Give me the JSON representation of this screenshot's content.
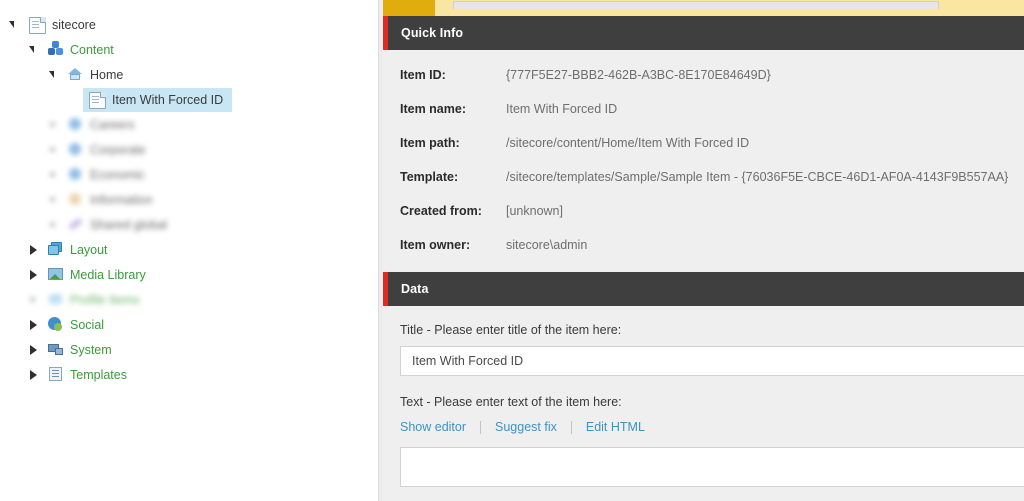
{
  "sidebar": {
    "tree": [
      {
        "label": "sitecore",
        "icon": "document-icon",
        "indent": 0,
        "twisty": "expanded",
        "green": false,
        "selected": false,
        "blurred": false
      },
      {
        "label": "Content",
        "icon": "cubes-icon",
        "indent": 1,
        "twisty": "expanded",
        "green": true,
        "selected": false,
        "blurred": false
      },
      {
        "label": "Home",
        "icon": "home-icon",
        "indent": 2,
        "twisty": "expanded",
        "green": false,
        "selected": false,
        "blurred": false
      },
      {
        "label": "Item With Forced ID",
        "icon": "document-icon",
        "indent": 3,
        "twisty": "none-hidden",
        "green": false,
        "selected": true,
        "blurred": false
      },
      {
        "label": "Careers",
        "icon": "globe-blue-icon",
        "indent": 2,
        "twisty": "none",
        "green": false,
        "selected": false,
        "blurred": true
      },
      {
        "label": "Corporate",
        "icon": "globe-blue-icon",
        "indent": 2,
        "twisty": "none",
        "green": false,
        "selected": false,
        "blurred": true
      },
      {
        "label": "Economic",
        "icon": "globe-blue-icon",
        "indent": 2,
        "twisty": "none",
        "green": false,
        "selected": false,
        "blurred": true
      },
      {
        "label": "Information",
        "icon": "globe-orange-icon",
        "indent": 2,
        "twisty": "none",
        "green": false,
        "selected": false,
        "blurred": true
      },
      {
        "label": "Shared global",
        "icon": "pencil-icon",
        "indent": 2,
        "twisty": "none",
        "green": false,
        "selected": false,
        "blurred": true
      },
      {
        "label": "Layout",
        "icon": "layout-icon",
        "indent": 1,
        "twisty": "collapsed",
        "green": true,
        "selected": false,
        "blurred": false
      },
      {
        "label": "Media Library",
        "icon": "media-icon",
        "indent": 1,
        "twisty": "collapsed",
        "green": true,
        "selected": false,
        "blurred": false
      },
      {
        "label": "Profile Items",
        "icon": "profile-icon",
        "indent": 1,
        "twisty": "none",
        "green": true,
        "selected": false,
        "blurred": true
      },
      {
        "label": "Social",
        "icon": "social-icon",
        "indent": 1,
        "twisty": "collapsed",
        "green": true,
        "selected": false,
        "blurred": false
      },
      {
        "label": "System",
        "icon": "system-icon",
        "indent": 1,
        "twisty": "collapsed",
        "green": true,
        "selected": false,
        "blurred": false
      },
      {
        "label": "Templates",
        "icon": "templates-icon",
        "indent": 1,
        "twisty": "collapsed",
        "green": true,
        "selected": false,
        "blurred": false
      }
    ]
  },
  "ribbon": {
    "active_tab_color": "#e0ad0c",
    "strip_color": "#fae6a0"
  },
  "quick_info": {
    "header": "Quick Info",
    "accent_color": "#e02b20",
    "rows": [
      {
        "label": "Item ID:",
        "value": "{777F5E27-BBB2-462B-A3BC-8E170E84649D}"
      },
      {
        "label": "Item name:",
        "value": "Item With Forced ID"
      },
      {
        "label": "Item path:",
        "value": "/sitecore/content/Home/Item With Forced ID"
      },
      {
        "label": "Template:",
        "value": "/sitecore/templates/Sample/Sample Item - {76036F5E-CBCE-46D1-AF0A-4143F9B557AA}"
      },
      {
        "label": "Created from:",
        "value": "[unknown]"
      },
      {
        "label": "Item owner:",
        "value": "sitecore\\admin"
      }
    ]
  },
  "data_section": {
    "header": "Data",
    "title_field": {
      "label": "Title - Please enter title of the item here:",
      "value": "Item With Forced ID"
    },
    "text_field": {
      "label": "Text - Please enter text of the item here:",
      "value": "",
      "links": [
        {
          "label": "Show editor"
        },
        {
          "label": "Suggest fix"
        },
        {
          "label": "Edit HTML"
        }
      ]
    }
  }
}
